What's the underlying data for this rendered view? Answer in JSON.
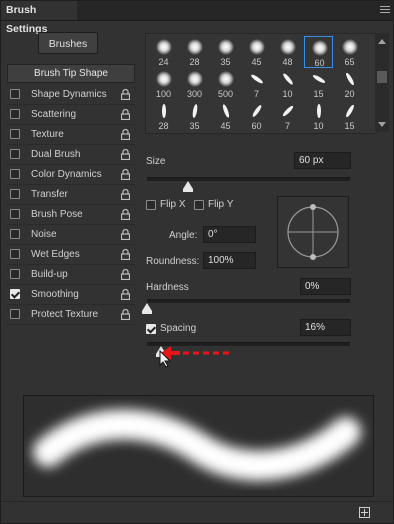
{
  "panel": {
    "tab_title": "Brush Settings",
    "brushes_button": "Brushes"
  },
  "sidebar": {
    "items": [
      {
        "label": "Brush Tip Shape",
        "checkbox": false,
        "checked": false,
        "locked": false
      },
      {
        "label": "Shape Dynamics",
        "checkbox": true,
        "checked": false,
        "locked": true
      },
      {
        "label": "Scattering",
        "checkbox": true,
        "checked": false,
        "locked": true
      },
      {
        "label": "Texture",
        "checkbox": true,
        "checked": false,
        "locked": true
      },
      {
        "label": "Dual Brush",
        "checkbox": true,
        "checked": false,
        "locked": true
      },
      {
        "label": "Color Dynamics",
        "checkbox": true,
        "checked": false,
        "locked": true
      },
      {
        "label": "Transfer",
        "checkbox": true,
        "checked": false,
        "locked": true
      },
      {
        "label": "Brush Pose",
        "checkbox": true,
        "checked": false,
        "locked": true
      },
      {
        "label": "Noise",
        "checkbox": true,
        "checked": false,
        "locked": true
      },
      {
        "label": "Wet Edges",
        "checkbox": true,
        "checked": false,
        "locked": true
      },
      {
        "label": "Build-up",
        "checkbox": true,
        "checked": false,
        "locked": true
      },
      {
        "label": "Smoothing",
        "checkbox": true,
        "checked": true,
        "locked": true
      },
      {
        "label": "Protect Texture",
        "checkbox": true,
        "checked": false,
        "locked": true
      }
    ]
  },
  "presets": [
    {
      "size": "24",
      "kind": "soft-round"
    },
    {
      "size": "28",
      "kind": "soft-round"
    },
    {
      "size": "35",
      "kind": "soft-round"
    },
    {
      "size": "45",
      "kind": "soft-round"
    },
    {
      "size": "48",
      "kind": "soft-round"
    },
    {
      "size": "60",
      "kind": "soft-round",
      "selected": true
    },
    {
      "size": "65",
      "kind": "soft-round"
    },
    {
      "size": "100",
      "kind": "soft-round"
    },
    {
      "size": "300",
      "kind": "soft-round"
    },
    {
      "size": "500",
      "kind": "soft-round"
    },
    {
      "size": "7",
      "kind": "angled"
    },
    {
      "size": "10",
      "kind": "angled"
    },
    {
      "size": "15",
      "kind": "angled"
    },
    {
      "size": "20",
      "kind": "angled"
    },
    {
      "size": "28",
      "kind": "angled"
    },
    {
      "size": "35",
      "kind": "angled"
    },
    {
      "size": "45",
      "kind": "angled"
    },
    {
      "size": "60",
      "kind": "angled"
    },
    {
      "size": "7",
      "kind": "angled"
    },
    {
      "size": "10",
      "kind": "angled"
    },
    {
      "size": "15",
      "kind": "angled"
    }
  ],
  "tip": {
    "size_label": "Size",
    "size_value": "60 px",
    "size_level": 0.2,
    "flip_x": "Flip X",
    "flip_y": "Flip Y",
    "angle_label": "Angle:",
    "angle_value": "0°",
    "roundness_label": "Roundness:",
    "roundness_value": "100%",
    "hardness_label": "Hardness",
    "hardness_value": "0%",
    "hardness_level": 0.0,
    "spacing_label": "Spacing",
    "spacing_checked": true,
    "spacing_value": "16%",
    "spacing_level": 0.07
  },
  "colors": {
    "panel_bg": "#323232",
    "selection": "#3a8ee6",
    "annotation_arrow": "#e8141b"
  },
  "icons": {
    "lock": "lock-icon",
    "menu": "panel-menu-icon",
    "new_preset": "new-preset-icon",
    "cursor": "mouse-pointer-icon"
  }
}
